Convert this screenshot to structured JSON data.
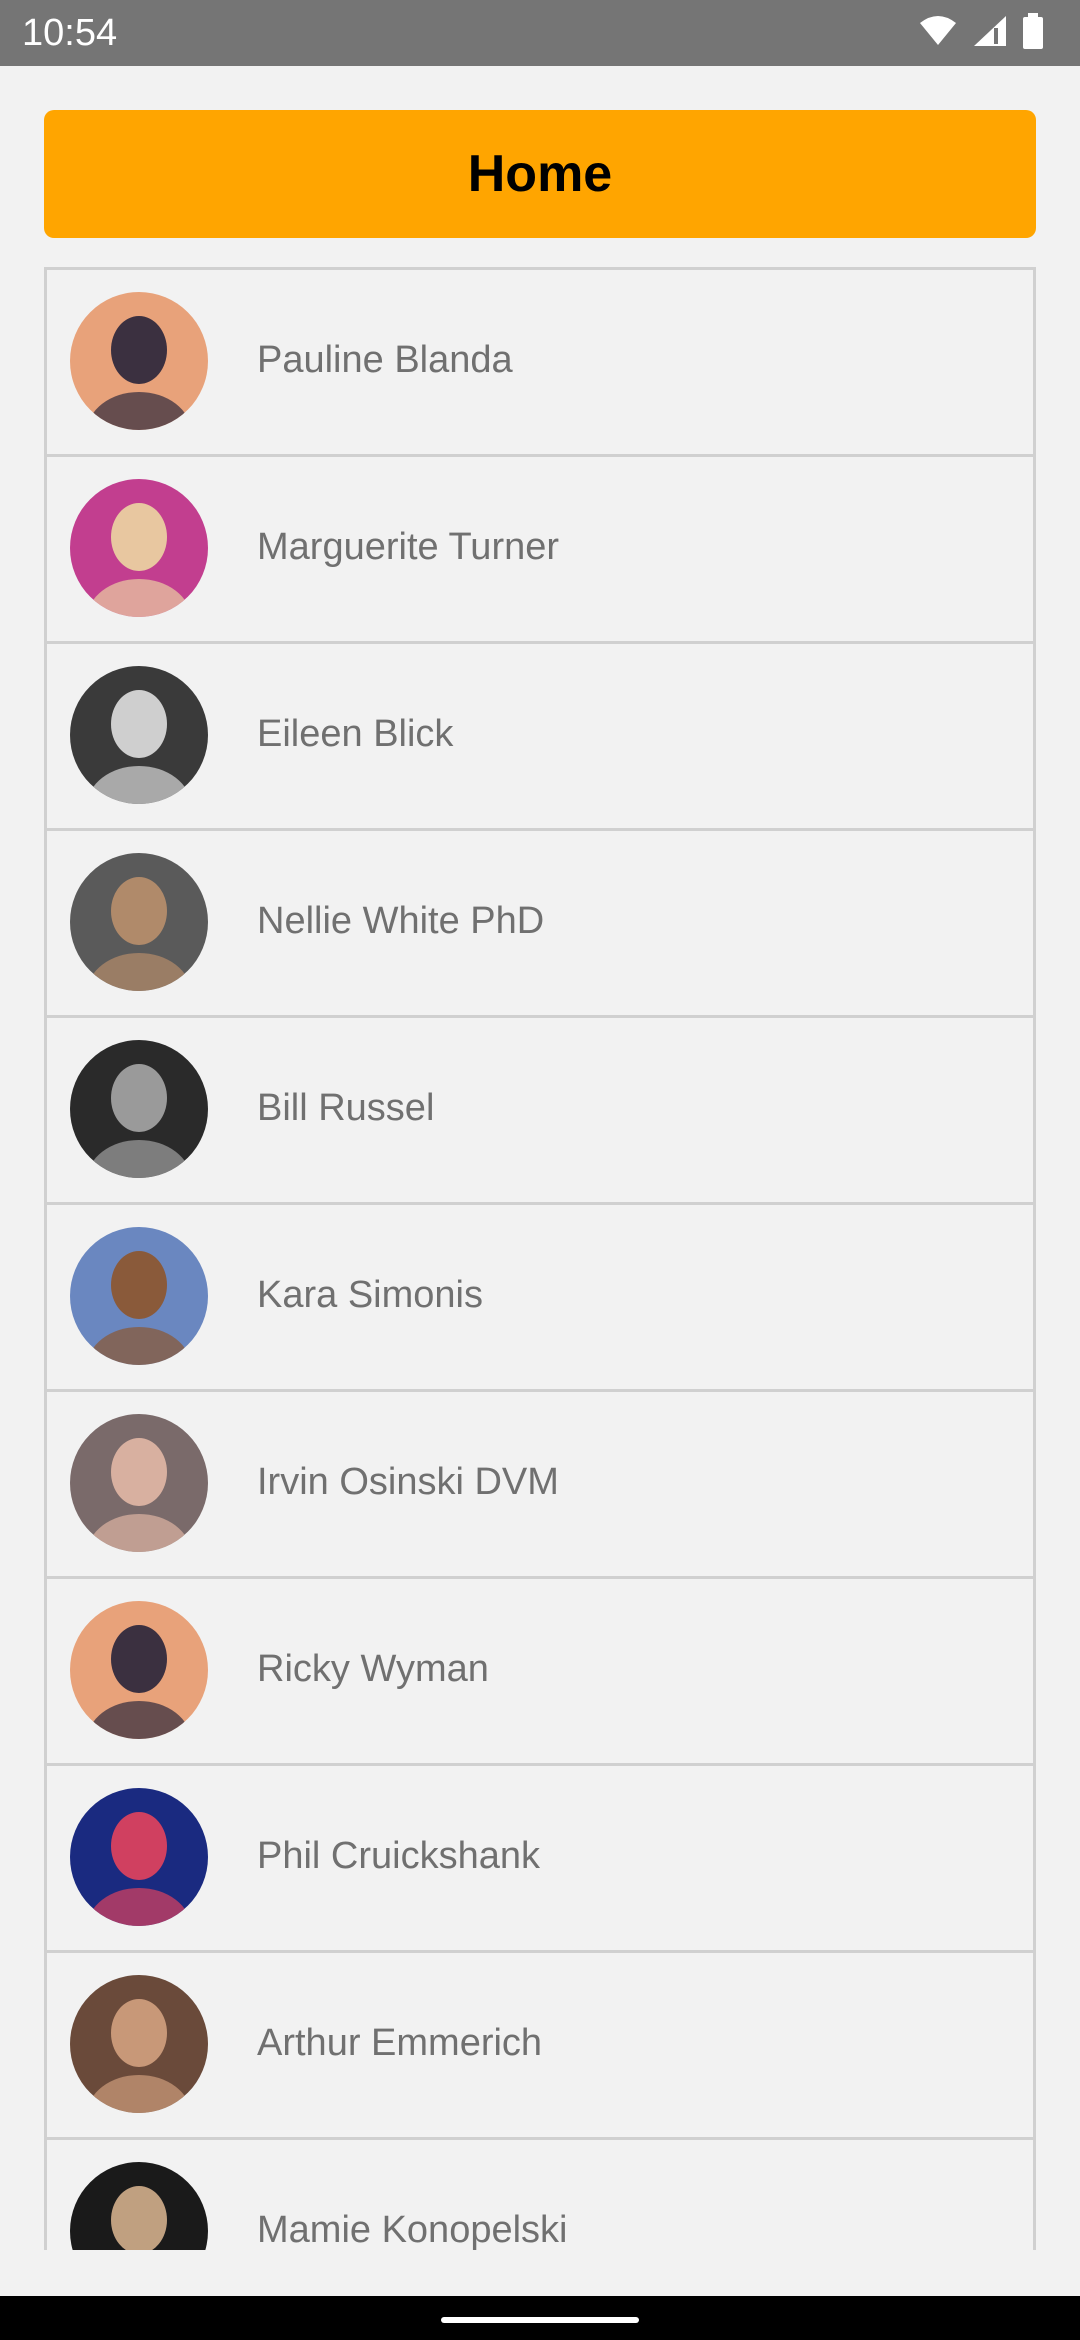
{
  "status_bar": {
    "time": "10:54",
    "icons": [
      "wifi-icon",
      "signal-icon",
      "battery-icon"
    ]
  },
  "header": {
    "title": "Home",
    "color": "#FFA500"
  },
  "contacts": [
    {
      "name": "Pauline Blanda",
      "avatar_colors": [
        "#e8a27a",
        "#3b3040"
      ]
    },
    {
      "name": "Marguerite Turner",
      "avatar_colors": [
        "#c23e8f",
        "#e8c7a0"
      ]
    },
    {
      "name": "Eileen Blick",
      "avatar_colors": [
        "#3a3a3a",
        "#cfcfcf"
      ]
    },
    {
      "name": "Nellie White PhD",
      "avatar_colors": [
        "#5a5a5a",
        "#b08a6a"
      ]
    },
    {
      "name": "Bill Russel",
      "avatar_colors": [
        "#2a2a2a",
        "#9a9a9a"
      ]
    },
    {
      "name": "Kara Simonis",
      "avatar_colors": [
        "#6a87c0",
        "#8a5a3a"
      ]
    },
    {
      "name": "Irvin Osinski DVM",
      "avatar_colors": [
        "#7a6a6a",
        "#d8b0a0"
      ]
    },
    {
      "name": "Ricky Wyman",
      "avatar_colors": [
        "#e8a27a",
        "#3b3040"
      ]
    },
    {
      "name": "Phil Cruickshank",
      "avatar_colors": [
        "#1a2a80",
        "#d04060"
      ]
    },
    {
      "name": "Arthur Emmerich",
      "avatar_colors": [
        "#6a4a3a",
        "#c89878"
      ]
    },
    {
      "name": "Mamie Konopelski",
      "avatar_colors": [
        "#1a1a1a",
        "#c0a080"
      ]
    }
  ]
}
